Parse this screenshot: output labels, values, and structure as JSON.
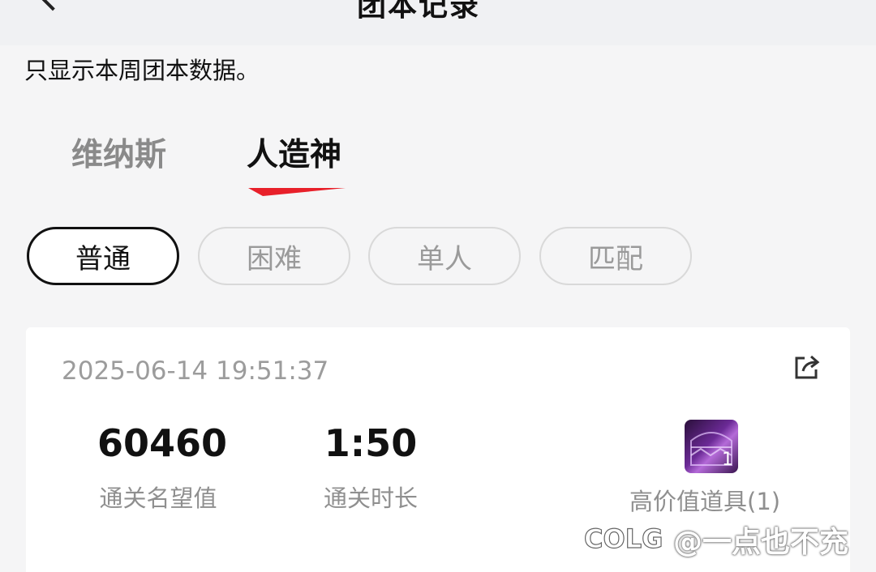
{
  "header": {
    "title": "团本记录"
  },
  "notice": "只显示本周团本数据。",
  "tabs": [
    {
      "label": "维纳斯",
      "active": false
    },
    {
      "label": "人造神",
      "active": true
    }
  ],
  "accent_color": "#e8202a",
  "filters": [
    {
      "label": "普通",
      "selected": true
    },
    {
      "label": "困难",
      "selected": false
    },
    {
      "label": "单人",
      "selected": false
    },
    {
      "label": "匹配",
      "selected": false
    }
  ],
  "record": {
    "time": "2025-06-14 19:51:37",
    "fame_value": "60460",
    "fame_label": "通关名望值",
    "duration_value": "1:50",
    "duration_label": "通关时长",
    "item_count": "1",
    "item_label": "高价值道具(1)"
  },
  "watermark": {
    "logo": "COLG",
    "text": "@一点也不充"
  }
}
